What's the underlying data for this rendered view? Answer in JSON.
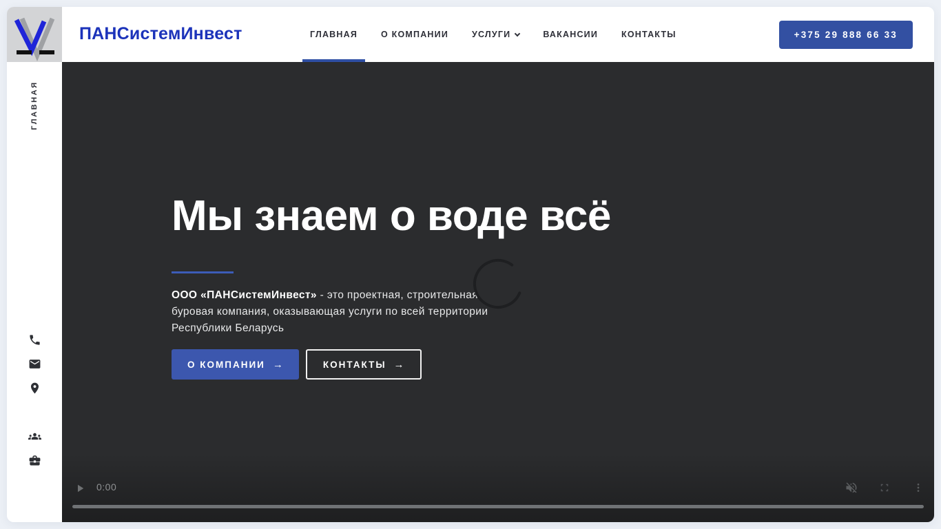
{
  "brand": {
    "name": "ПАНСистемИнвест"
  },
  "nav": {
    "items": [
      {
        "label": "ГЛАВНАЯ",
        "active": true
      },
      {
        "label": "О КОМПАНИИ",
        "active": false
      },
      {
        "label": "УСЛУГИ",
        "active": false,
        "has_dropdown": true
      },
      {
        "label": "ВАКАНСИИ",
        "active": false
      },
      {
        "label": "КОНТАКТЫ",
        "active": false
      }
    ],
    "phone_button_label": "+375 29 888 66 33"
  },
  "sidebar": {
    "vertical_label": "ГЛАВНАЯ",
    "icons": [
      "phone-icon",
      "envelope-icon",
      "location-pin-icon",
      "users-icon",
      "briefcase-icon"
    ]
  },
  "hero": {
    "title": "Мы знаем о воде всё",
    "description_bold": "ООО «ПАНСистемИнвест»",
    "description_rest": " - это проектная, строительная, буровая компания, оказывающая услуги по всей территории Республики Беларусь",
    "primary_button_label": "О КОМПАНИИ",
    "secondary_button_label": "КОНТАКТЫ",
    "button_arrow": "→"
  },
  "video": {
    "current_time": "0:00",
    "state": "loading",
    "muted": true
  },
  "colors": {
    "accent_blue": "#3c57ae",
    "phone_button_blue": "#3350a2",
    "brand_blue": "#1c33ba",
    "nav_underline_blue": "#2f4fa4",
    "hero_background": "#2b2c2e",
    "page_background": "#ecf0f6",
    "logo_square_gray": "#d3d4d6"
  }
}
